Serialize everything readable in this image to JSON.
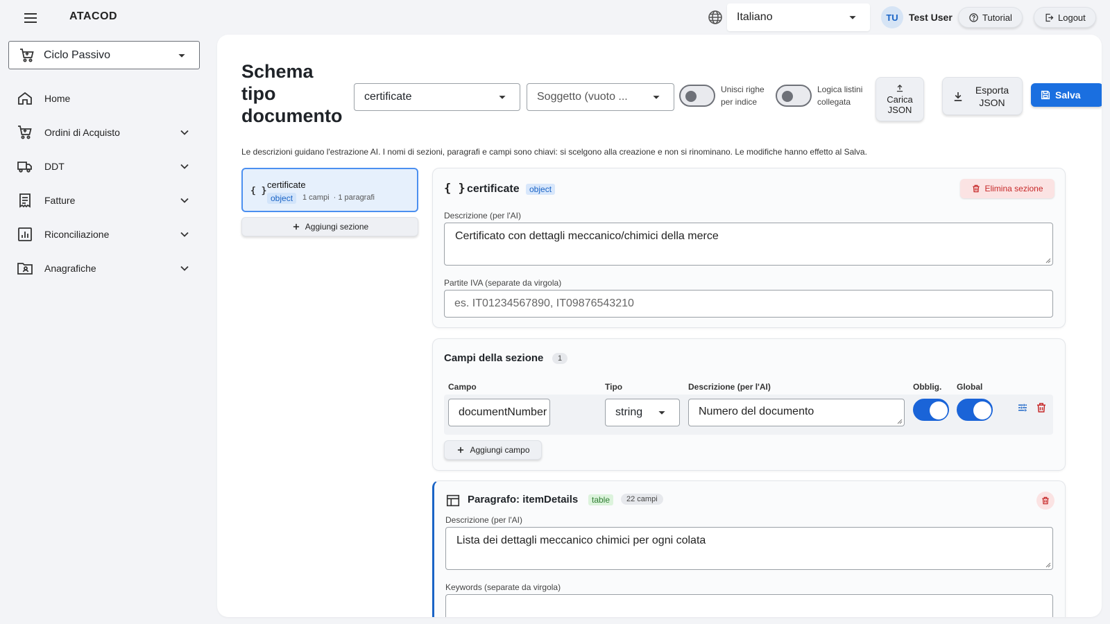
{
  "app": {
    "title": "ATACOD"
  },
  "header": {
    "language": "Italiano",
    "user_initials": "TU",
    "user_name": "Test User",
    "tutorial_label": "Tutorial",
    "logout_label": "Logout"
  },
  "sidebar": {
    "module": "Ciclo Passivo",
    "items": [
      {
        "label": "Home",
        "icon": "home-icon",
        "expandable": false
      },
      {
        "label": "Ordini di Acquisto",
        "icon": "cart-icon",
        "expandable": true
      },
      {
        "label": "DDT",
        "icon": "truck-icon",
        "expandable": true
      },
      {
        "label": "Fatture",
        "icon": "invoice-icon",
        "expandable": true
      },
      {
        "label": "Riconciliazione",
        "icon": "chart-icon",
        "expandable": true
      },
      {
        "label": "Anagrafiche",
        "icon": "contacts-icon",
        "expandable": true
      }
    ]
  },
  "toolbar": {
    "page_title": "Schema tipo documento",
    "document_type": "certificate",
    "subject_placeholder": "Soggetto (vuoto ...",
    "merge_rows_label": "Unisci righe per indice",
    "merge_rows_on": false,
    "linked_lists_label": "Logica listini collegata",
    "linked_lists_on": false,
    "load_json_label": "Carica JSON",
    "export_json_label": "Esporta JSON",
    "save_label": "Salva"
  },
  "hint": "Le descrizioni guidano l'estrazione AI. I nomi di sezioni, paragrafi e campi sono chiavi: si scelgono alla creazione e non si rinominano. Le modifiche hanno effetto al Salva.",
  "sections_list": {
    "items": [
      {
        "name": "certificate",
        "type": "object",
        "fields_count": "1 campi",
        "paragraphs_count": "· 1 paragrafi"
      }
    ],
    "add_label": "Aggiungi sezione"
  },
  "section": {
    "name": "certificate",
    "type": "object",
    "delete_label": "Elimina sezione",
    "description_label": "Descrizione (per l'AI)",
    "description": "Certificato con dettagli meccanico/chimici della merce",
    "vat_label": "Partite IVA (separate da virgola)",
    "vat_placeholder": "es. IT01234567890, IT09876543210"
  },
  "fields": {
    "title": "Campi della sezione",
    "count": "1",
    "columns": {
      "field": "Campo",
      "type": "Tipo",
      "description": "Descrizione (per l'AI)",
      "required": "Obblig.",
      "global": "Global"
    },
    "rows": [
      {
        "name": "documentNumber",
        "type": "string",
        "description": "Numero del documento",
        "required": true,
        "global": true
      }
    ],
    "add_label": "Aggiungi campo"
  },
  "paragraph": {
    "title": "Paragrafo: itemDetails",
    "type": "table",
    "fields_count": "22 campi",
    "description_label": "Descrizione (per l'AI)",
    "description": "Lista dei dettagli meccanico chimici per ogni colata",
    "keywords_label": "Keywords (separate da virgola)"
  },
  "colors": {
    "accent": "#1a6fe0",
    "danger": "#c62828",
    "selected_bg": "#e6f0fc"
  }
}
